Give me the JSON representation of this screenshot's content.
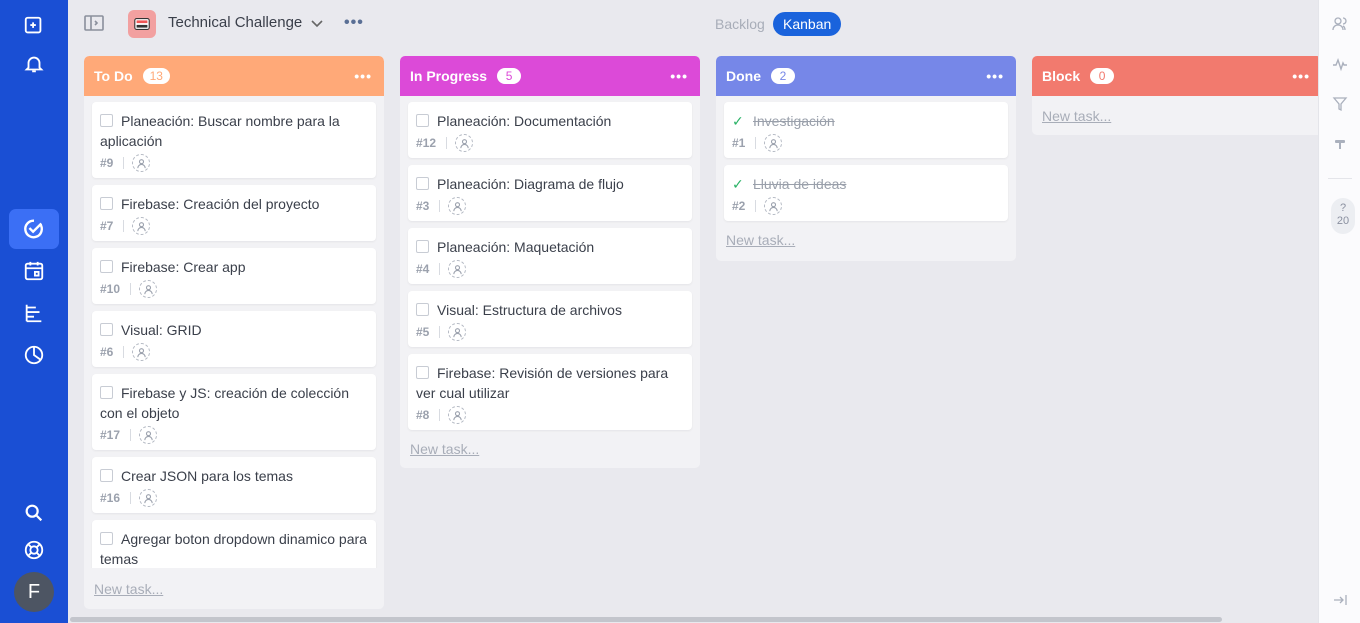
{
  "app": {
    "colors": {
      "sidebar": "#1a4fd4",
      "accent": "#1a63dc"
    }
  },
  "sidebar": {
    "icons": [
      "new-task-icon",
      "bell-icon",
      "check-circle-icon",
      "calendar-icon",
      "timeline-icon",
      "chart-icon",
      "search-icon",
      "help-lifebuoy-icon"
    ],
    "avatar_initial": "F"
  },
  "header": {
    "project_title": "Technical Challenge",
    "more": "•••",
    "views": {
      "backlog": "Backlog",
      "kanban": "Kanban"
    }
  },
  "rightrail": {
    "help_symbol": "?",
    "help_count": "20"
  },
  "columns": [
    {
      "title": "To Do",
      "count": "13",
      "color": "#ffa978",
      "more": "•••",
      "new_task": "New task...",
      "cards": [
        {
          "title": "Planeación: Buscar nombre para la aplicación",
          "id": "#9"
        },
        {
          "title": "Firebase: Creación del proyecto",
          "id": "#7"
        },
        {
          "title": "Firebase: Crear app",
          "id": "#10"
        },
        {
          "title": "Visual: GRID",
          "id": "#6"
        },
        {
          "title": "Firebase y JS: creación de colección con el objeto",
          "id": "#17"
        },
        {
          "title": "Crear JSON para los temas",
          "id": "#16"
        },
        {
          "title": "Agregar boton dropdown dinamico para temas",
          "id": ""
        }
      ]
    },
    {
      "title": "In Progress",
      "count": "5",
      "color": "#dc4ad8",
      "more": "•••",
      "new_task": "New task...",
      "cards": [
        {
          "title": "Planeación: Documentación",
          "id": "#12"
        },
        {
          "title": "Planeación: Diagrama de flujo",
          "id": "#3"
        },
        {
          "title": "Planeación: Maquetación",
          "id": "#4"
        },
        {
          "title": "Visual: Estructura de archivos",
          "id": "#5"
        },
        {
          "title": "Firebase: Revisión de versiones para ver cual utilizar",
          "id": "#8"
        }
      ]
    },
    {
      "title": "Done",
      "count": "2",
      "color": "#7687e8",
      "more": "•••",
      "new_task": "New task...",
      "cards": [
        {
          "title": "Investigación",
          "id": "#1"
        },
        {
          "title": "Lluvia de ideas",
          "id": "#2"
        }
      ]
    },
    {
      "title": "Block",
      "count": "0",
      "color": "#f27a6e",
      "more": "•••",
      "new_task": "New task...",
      "cards": []
    }
  ]
}
